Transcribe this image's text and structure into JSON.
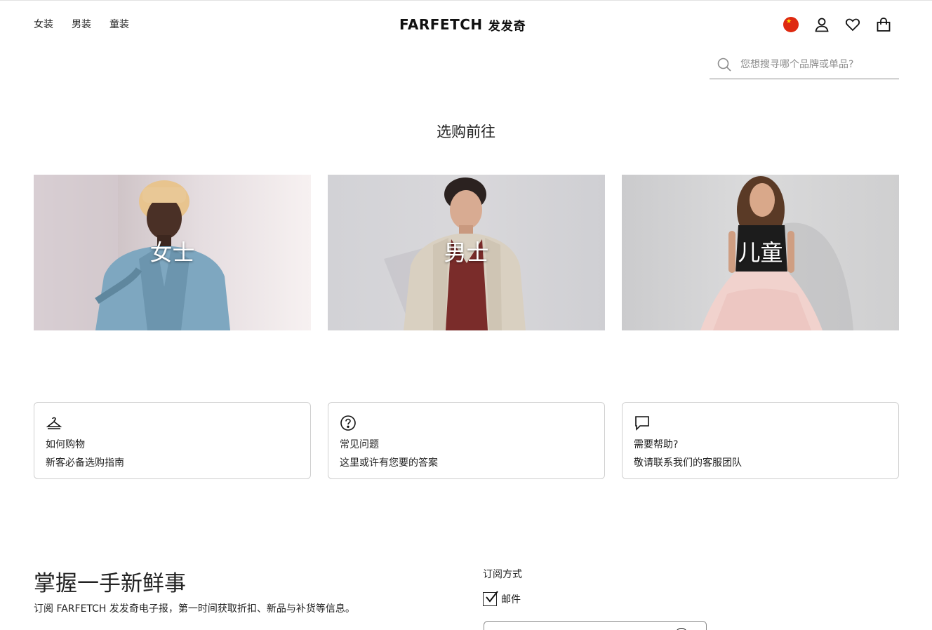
{
  "header": {
    "nav": [
      "女装",
      "男装",
      "童装"
    ],
    "logo_latin": "FARFETCH",
    "logo_cjk": "发发奇",
    "icons": [
      "china-flag-icon",
      "account-icon",
      "wishlist-heart-icon",
      "shopping-bag-icon"
    ]
  },
  "search": {
    "placeholder": "您想搜寻哪个品牌或单品?"
  },
  "shop_section": {
    "title": "选购前往",
    "categories": [
      {
        "label": "女士"
      },
      {
        "label": "男士"
      },
      {
        "label": "儿童"
      }
    ]
  },
  "help_cards": [
    {
      "icon": "hanger-icon",
      "title": "如何购物",
      "subtitle": "新客必备选购指南"
    },
    {
      "icon": "question-circle-icon",
      "title": "常见问题",
      "subtitle": "这里或许有您要的答案"
    },
    {
      "icon": "chat-bubble-icon",
      "title": "需要帮助?",
      "subtitle": "敬请联系我们的客服团队"
    }
  ],
  "newsletter": {
    "title": "掌握一手新鲜事",
    "description": "订阅 FARFETCH 发发奇电子报，第一时间获取折扣、新品与补货等信息。",
    "subscribe_label": "订阅方式",
    "option_label": "邮件",
    "option_checked": true
  },
  "colors": {
    "text": "#222222",
    "border": "#cfcfcf",
    "flag_red": "#de2910",
    "flag_star": "#ffde00"
  }
}
